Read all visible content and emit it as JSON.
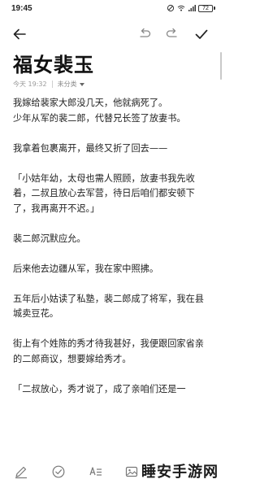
{
  "status_bar": {
    "time": "19:45",
    "battery": "72",
    "icons": [
      "do-not-disturb-icon",
      "wifi-icon",
      "signal-icon",
      "battery-icon"
    ]
  },
  "toolbar": {
    "icons": [
      "back-arrow-icon",
      "undo-icon",
      "redo-icon",
      "checkmark-icon"
    ]
  },
  "note": {
    "title": "福女裴玉",
    "meta": {
      "time": "今天 19:32",
      "category": "未分类"
    },
    "paragraphs": [
      "我嫁给裴家大郎没几天，他就病死了。",
      "少年从军的裴二郎，代替兄长签了放妻书。",
      "",
      "我拿着包裹离开，最终又折了回去——",
      "",
      "「小姑年幼，太母也需人照顾，放妻书我先收着，二叔且放心去军营，待日后咱们都安顿下了，我再离开不迟。」",
      "",
      "裴二郎沉默应允。",
      "",
      "后来他去边疆从军，我在家中照拂。",
      "",
      "五年后小姑读了私塾，裴二郎成了将军，我在县城卖豆花。",
      "",
      "街上有个姓陈的秀才待我甚好，我便跟回家省亲的二郎商议，想要嫁给秀才。",
      "",
      "「二叔放心，秀才说了，成了亲咱们还是一"
    ]
  },
  "bottom_bar": {
    "icons": [
      "pen-icon",
      "checklist-icon",
      "text-format-icon",
      "image-icon"
    ]
  },
  "watermark": "睡安手游网",
  "colors": {
    "text": "#222222",
    "meta": "#9a9a9a",
    "background": "#ffffff"
  }
}
